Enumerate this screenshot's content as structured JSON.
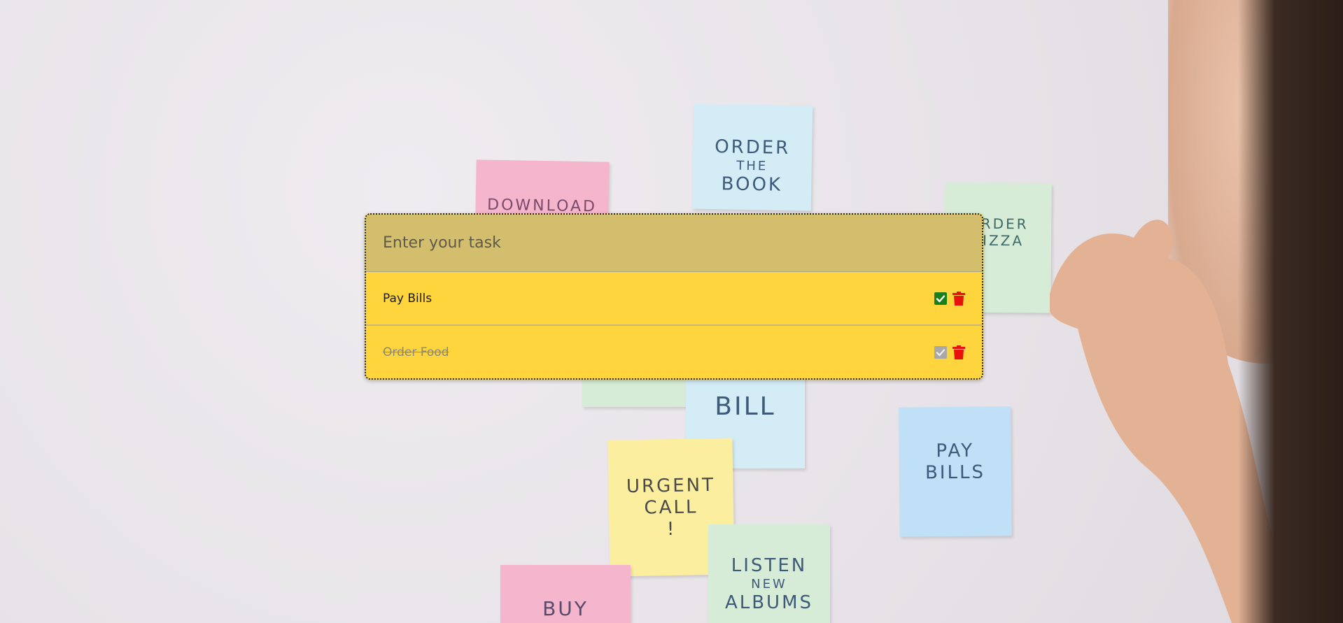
{
  "todo": {
    "input_placeholder": "Enter your task",
    "input_value": "",
    "tasks": [
      {
        "label": "Pay Bills",
        "completed": false
      },
      {
        "label": "Order Food",
        "completed": true
      }
    ]
  },
  "background": {
    "notes": [
      {
        "text": [
          "ORDER",
          "THE",
          "BOOK"
        ]
      },
      {
        "text": [
          "DOWNLOAD"
        ]
      },
      {
        "text": [
          "ORDER",
          "PIZZA"
        ]
      },
      {
        "text": [
          "BILL"
        ]
      },
      {
        "text": [
          "PAY",
          "BILLS"
        ]
      },
      {
        "text": [
          "URGENT",
          "CALL",
          "!"
        ]
      },
      {
        "text": [
          "LISTEN",
          "NEW",
          "ALBUMS"
        ]
      },
      {
        "text": [
          "BUY"
        ]
      }
    ]
  },
  "colors": {
    "panel_header": "#d3be6e",
    "panel_row": "#fed53d",
    "check_active": "#1a7f1a",
    "check_done": "#a8a8a8",
    "trash": "#e8120c"
  },
  "icons": {
    "check": "check-square-icon",
    "delete": "trash-icon"
  }
}
